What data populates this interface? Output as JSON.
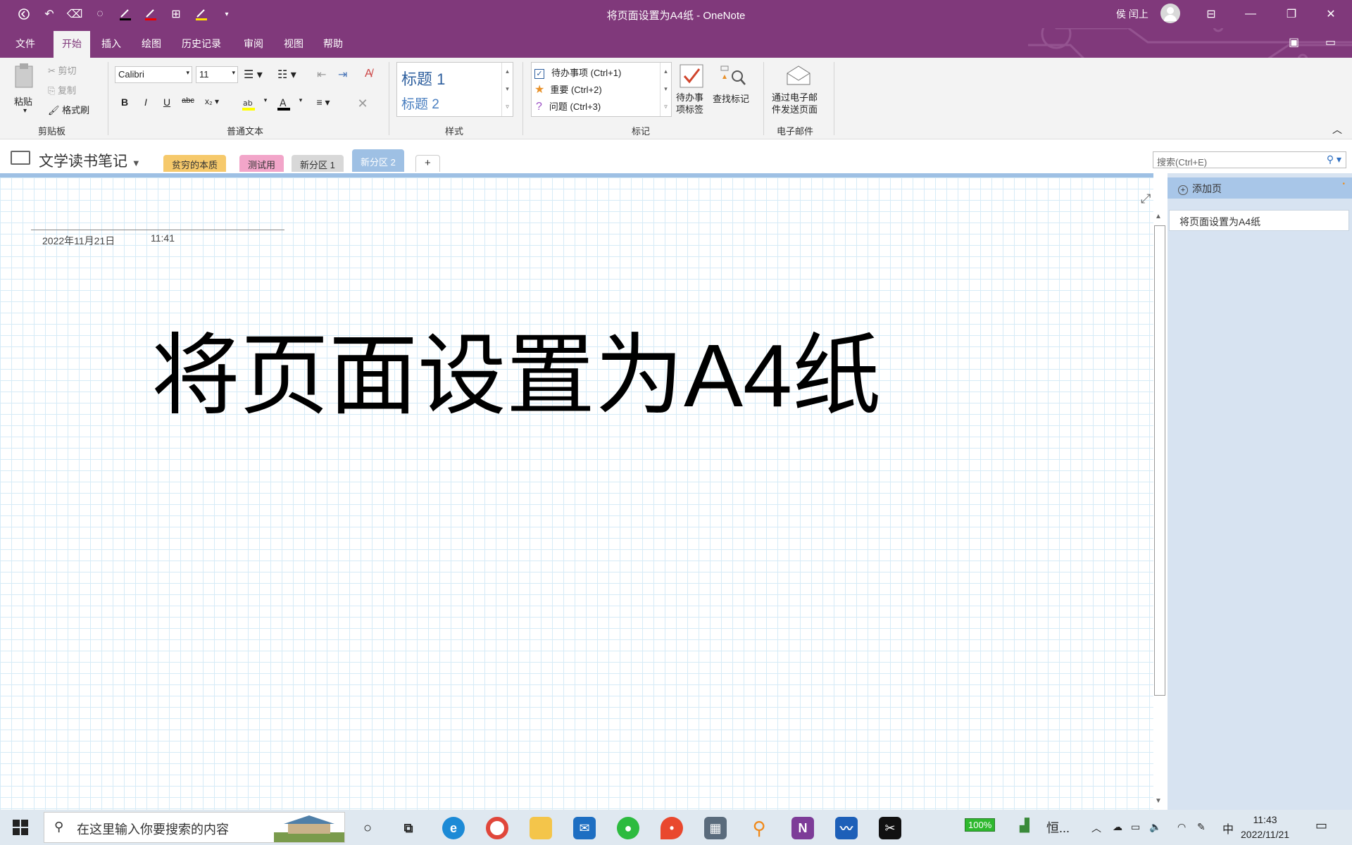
{
  "window": {
    "title": "将页面设置为A4纸  -  OneNote",
    "user": "侯 闰上"
  },
  "menu": {
    "tabs": [
      "文件",
      "开始",
      "插入",
      "绘图",
      "历史记录",
      "审阅",
      "视图",
      "帮助"
    ],
    "active_tab": "开始"
  },
  "ribbon": {
    "clipboard": {
      "paste": "粘贴",
      "cut": "剪切",
      "copy": "复制",
      "format_painter": "格式刷",
      "label": "剪贴板"
    },
    "text": {
      "font": "Calibri",
      "size": "11",
      "label": "普通文本"
    },
    "styles": {
      "h1": "标题 1",
      "h2": "标题 2",
      "label": "样式"
    },
    "tags": {
      "items": [
        "待办事项 (Ctrl+1)",
        "重要 (Ctrl+2)",
        "问题 (Ctrl+3)"
      ],
      "todo_tag": "待办事\n项标签",
      "find_tags": "查找标记",
      "label": "标记"
    },
    "email": {
      "send": "通过电子邮\n件发送页面",
      "label": "电子邮件"
    }
  },
  "notebook": {
    "name": "文学读书笔记",
    "sections": [
      {
        "name": "贫穷的本质",
        "color": "#f6c96b"
      },
      {
        "name": "测试用",
        "color": "#f2a5c9"
      },
      {
        "name": "新分区 1",
        "color": "#d8d8d8"
      },
      {
        "name": "新分区 2",
        "color": "#9ec0e4"
      }
    ],
    "add_section": "+",
    "search_placeholder": "搜索(Ctrl+E)"
  },
  "page": {
    "date": "2022年11月21日",
    "time": "11:41",
    "content": "将页面设置为A4纸"
  },
  "pages_panel": {
    "add_page": "添加页",
    "pages": [
      "将页面设置为A4纸"
    ]
  },
  "taskbar": {
    "search_placeholder": "在这里输入你要搜索的内容",
    "battery": "100%",
    "app_label": "恒...",
    "ime": "中",
    "time": "11:43",
    "date": "2022/11/21"
  }
}
